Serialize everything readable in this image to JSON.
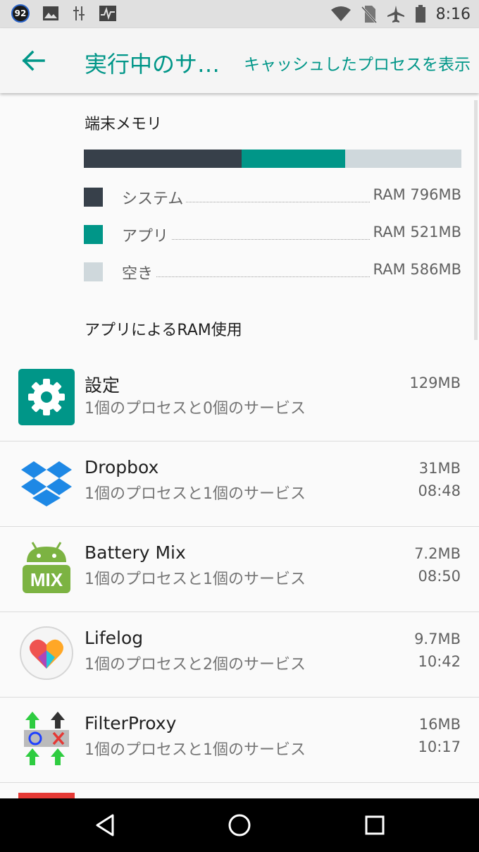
{
  "status_bar": {
    "badge": "92",
    "time": "8:16",
    "icons": [
      "notification-92-icon",
      "image-icon",
      "usb-icon",
      "pulse-icon",
      "wifi-icon",
      "no-sim-icon",
      "airplane-icon",
      "battery-icon"
    ]
  },
  "action_bar": {
    "title": "実行中のサ…",
    "action": "キャッシュしたプロセスを表示"
  },
  "memory": {
    "title": "端末メモリ",
    "segments": [
      {
        "label": "システム",
        "value": "RAM 796MB",
        "color": "#37404a",
        "fraction": 0.418
      },
      {
        "label": "アプリ",
        "value": "RAM 521MB",
        "color": "#009688",
        "fraction": 0.274
      },
      {
        "label": "空き",
        "value": "RAM 586MB",
        "color": "#cfd8dc",
        "fraction": 0.308
      }
    ]
  },
  "apps_section_title": "アプリによるRAM使用",
  "apps": [
    {
      "name": "設定",
      "sub": "1個のプロセスと0個のサービス",
      "size": "129MB",
      "time": "",
      "icon": "settings-gear-icon"
    },
    {
      "name": "Dropbox",
      "sub": "1個のプロセスと1個のサービス",
      "size": "31MB",
      "time": "08:48",
      "icon": "dropbox-icon"
    },
    {
      "name": "Battery Mix",
      "sub": "1個のプロセスと1個のサービス",
      "size": "7.2MB",
      "time": "08:50",
      "icon": "battery-mix-icon",
      "icon_text": "MIX"
    },
    {
      "name": "Lifelog",
      "sub": "1個のプロセスと2個のサービス",
      "size": "9.7MB",
      "time": "10:42",
      "icon": "lifelog-heart-icon"
    },
    {
      "name": "FilterProxy",
      "sub": "1個のプロセスと1個のサービス",
      "size": "16MB",
      "time": "10:17",
      "icon": "filterproxy-icon"
    }
  ],
  "nav": [
    "back-nav-icon",
    "home-nav-icon",
    "recents-nav-icon"
  ]
}
